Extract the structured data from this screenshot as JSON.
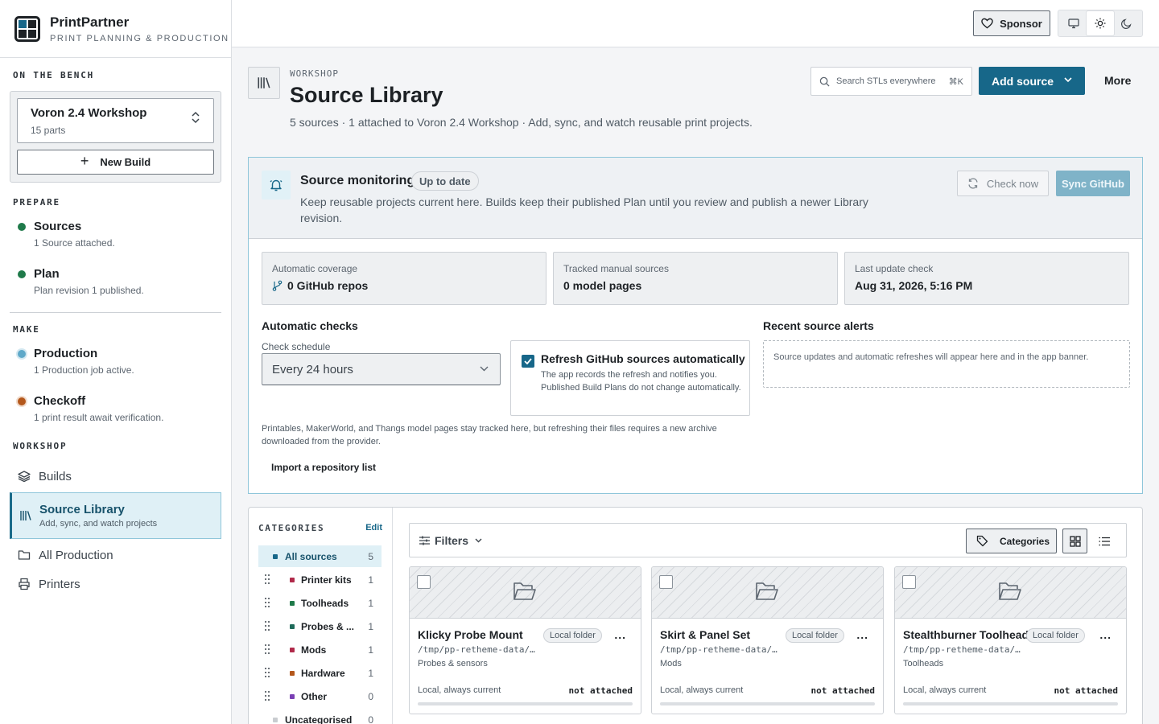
{
  "brand": {
    "name": "PrintPartner",
    "tagline": "PRINT PLANNING & PRODUCTION"
  },
  "bench": {
    "section": "ON THE BENCH",
    "build_name": "Voron 2.4 Workshop",
    "build_parts": "15 parts",
    "new_build_label": "New Build"
  },
  "prepare": {
    "section": "PREPARE",
    "stages": [
      {
        "label": "Sources",
        "sub": "1 Source attached.",
        "color": "#1f7a4a"
      },
      {
        "label": "Plan",
        "sub": "Plan revision 1 published.",
        "color": "#1f7a4a"
      }
    ]
  },
  "make": {
    "section": "MAKE",
    "stages": [
      {
        "label": "Production",
        "sub": "1 Production job active.",
        "color": "#5fa9c9"
      },
      {
        "label": "Checkoff",
        "sub": "1 print result await verification.",
        "color": "#b4581c"
      }
    ]
  },
  "workshop": {
    "section": "WORKSHOP",
    "builds": "Builds",
    "active": {
      "label": "Source Library",
      "sub": "Add, sync, and watch projects"
    },
    "all_production": "All Production",
    "printers": "Printers"
  },
  "topbar": {
    "sponsor_label": "Sponsor"
  },
  "header": {
    "eyebrow": "WORKSHOP",
    "title": "Source Library",
    "subtitle": "5 sources · 1 attached to Voron 2.4 Workshop · Add, sync, and watch reusable print projects.",
    "search_placeholder": "Search STLs everywhere",
    "search_shortcut": "⌘K",
    "add_source_label": "Add source",
    "more_label": "More"
  },
  "monitoring": {
    "title": "Source monitoring",
    "status": "Up to date",
    "description": "Keep reusable projects current here. Builds keep their published Plan until you review and publish a newer Library revision.",
    "check_now_label": "Check now",
    "sync_github_label": "Sync GitHub",
    "stats": [
      {
        "key": "Automatic coverage",
        "value": "0 GitHub repos"
      },
      {
        "key": "Tracked manual sources",
        "value": "0 model pages"
      },
      {
        "key": "Last update check",
        "value": "Aug 31, 2026, 5:16 PM"
      }
    ],
    "auto_checks_title": "Automatic checks",
    "schedule_label": "Check schedule",
    "schedule_value": "Every 24 hours",
    "auto_refresh_title": "Refresh GitHub sources automatically",
    "auto_refresh_desc": "The app records the refresh and notifies you. Published Build Plans do not change automatically.",
    "auto_refresh_checked": true,
    "alerts_title": "Recent source alerts",
    "alerts_empty": "Source updates and automatic refreshes will appear here and in the app banner.",
    "manual_note": "Printables, MakerWorld, and Thangs model pages stay tracked here, but refreshing their files requires a new archive downloaded from the provider.",
    "import_label": "Import a repository list"
  },
  "categories": {
    "title": "CATEGORIES",
    "edit_label": "Edit",
    "items": [
      {
        "name": "All sources",
        "count": "5",
        "color": "#176789"
      },
      {
        "name": "Printer kits",
        "count": "1",
        "color": "#b02a4a"
      },
      {
        "name": "Toolheads",
        "count": "1",
        "color": "#1f7a4a"
      },
      {
        "name": "Probes & ...",
        "count": "1",
        "color": "#1f6b5a"
      },
      {
        "name": "Mods",
        "count": "1",
        "color": "#b02a4a"
      },
      {
        "name": "Hardware",
        "count": "1",
        "color": "#b4581c"
      },
      {
        "name": "Other",
        "count": "0",
        "color": "#7a3fb4"
      },
      {
        "name": "Uncategorised",
        "count": "0",
        "color": "#c9ccd0"
      }
    ]
  },
  "toolbar": {
    "filters_label": "Filters",
    "categories_label": "Categories"
  },
  "cards": [
    {
      "title": "Klicky Probe Mount",
      "tag": "Local folder",
      "path": "/tmp/pp-retheme-data/…",
      "category": "Probes & sensors",
      "status": "Local, always current",
      "attach": "not attached"
    },
    {
      "title": "Skirt & Panel Set",
      "tag": "Local folder",
      "path": "/tmp/pp-retheme-data/…",
      "category": "Mods",
      "status": "Local, always current",
      "attach": "not attached"
    },
    {
      "title": "Stealthburner Toolhead",
      "tag": "Local folder",
      "path": "/tmp/pp-retheme-data/…",
      "category": "Toolheads",
      "status": "Local, always current",
      "attach": "not attached"
    }
  ]
}
